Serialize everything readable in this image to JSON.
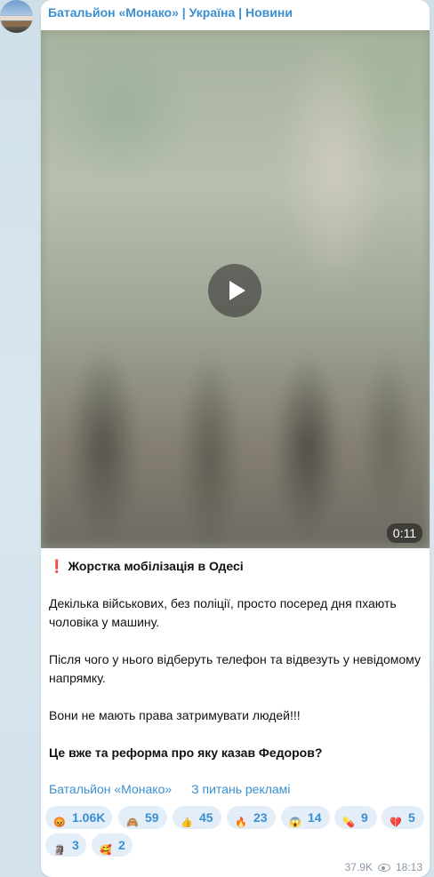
{
  "channel": {
    "name": "Батальйон «Монако» | Україна | Новини"
  },
  "video": {
    "duration": "0:11"
  },
  "post": {
    "title": "Жорстка мобілізація в Одесі",
    "paragraph1": "Декілька військових, без поліції, просто посеред дня пхають чоловіка у машину.",
    "paragraph2": "Після чого у нього відберуть телефон та відвезуть у невідомому напрямку.",
    "paragraph3": "Вони не мають права затримувати людей!!!",
    "paragraph4": "Це вже та реформа про яку казав Федоров?"
  },
  "links": {
    "channel_link": "Батальйон «Монако»",
    "ads_link": "З питань рекламі"
  },
  "reactions": [
    {
      "icon": "enraged-face-icon",
      "count": "1.06K",
      "color": "#e0463a",
      "glyph": "😡"
    },
    {
      "icon": "see-no-evil-monkey-icon",
      "count": "59",
      "color": "#b07a4a",
      "glyph": "🙈"
    },
    {
      "icon": "thumbs-up-icon",
      "count": "45",
      "color": "#f4b400",
      "glyph": "👍"
    },
    {
      "icon": "fire-icon",
      "count": "23",
      "color": "#f26a1b",
      "glyph": "🔥"
    },
    {
      "icon": "screaming-face-icon",
      "count": "14",
      "color": "#5a9be0",
      "glyph": "😱"
    },
    {
      "icon": "pill-icon",
      "count": "9",
      "color": "#e8564a",
      "glyph": "💊"
    },
    {
      "icon": "broken-heart-icon",
      "count": "5",
      "color": "#d8233a",
      "glyph": "💔"
    },
    {
      "icon": "moai-icon",
      "count": "3",
      "color": "#6d6d6d",
      "glyph": "🗿"
    },
    {
      "icon": "smiling-face-with-hearts-icon",
      "count": "2",
      "color": "#f7b529",
      "glyph": "🥰"
    }
  ],
  "meta": {
    "views": "37.9K",
    "time": "18:13"
  }
}
